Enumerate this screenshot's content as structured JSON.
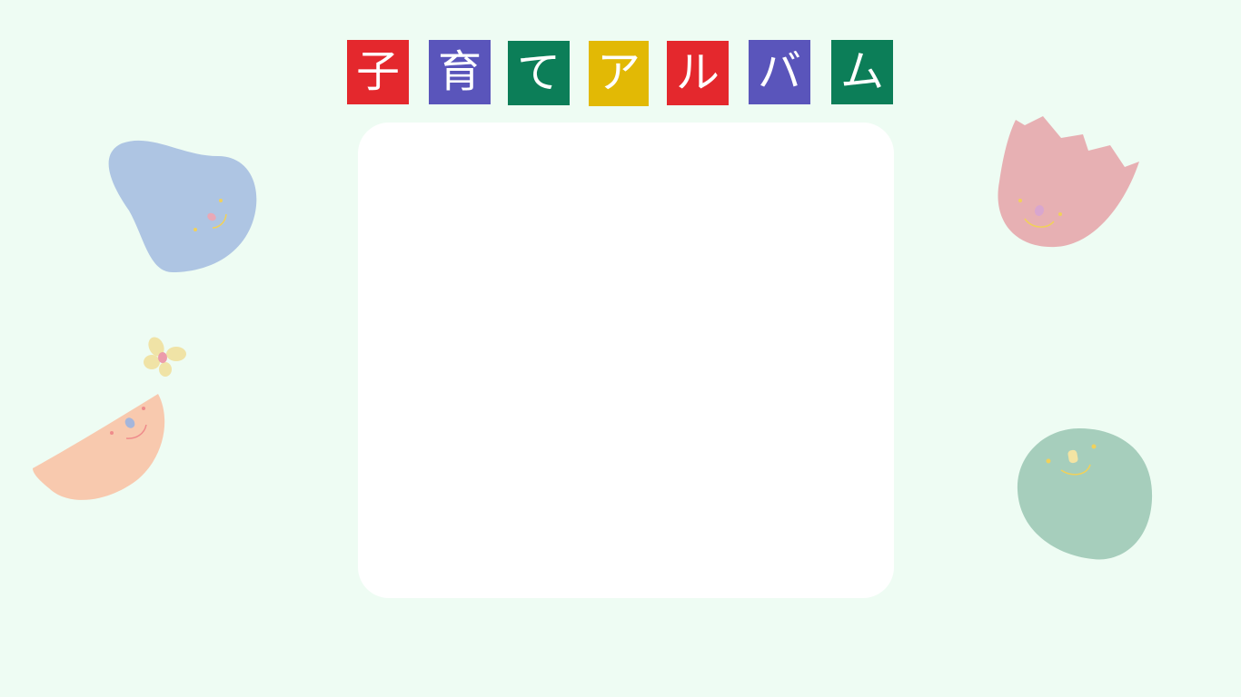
{
  "album": {
    "title_chars": [
      "子",
      "育",
      "て",
      "ア",
      "ル",
      "バ",
      "ム"
    ]
  },
  "colors": {
    "background": "#eefcf3",
    "red": "#e4282d",
    "purple": "#5a55bb",
    "green": "#0c7e58",
    "yellow": "#e2b905",
    "frame": "#ffffff"
  },
  "decorations": [
    "blue-blob-face-icon",
    "yellow-flower-icon",
    "orange-half-moon-face-icon",
    "pink-tulip-face-icon",
    "green-circle-face-icon"
  ]
}
